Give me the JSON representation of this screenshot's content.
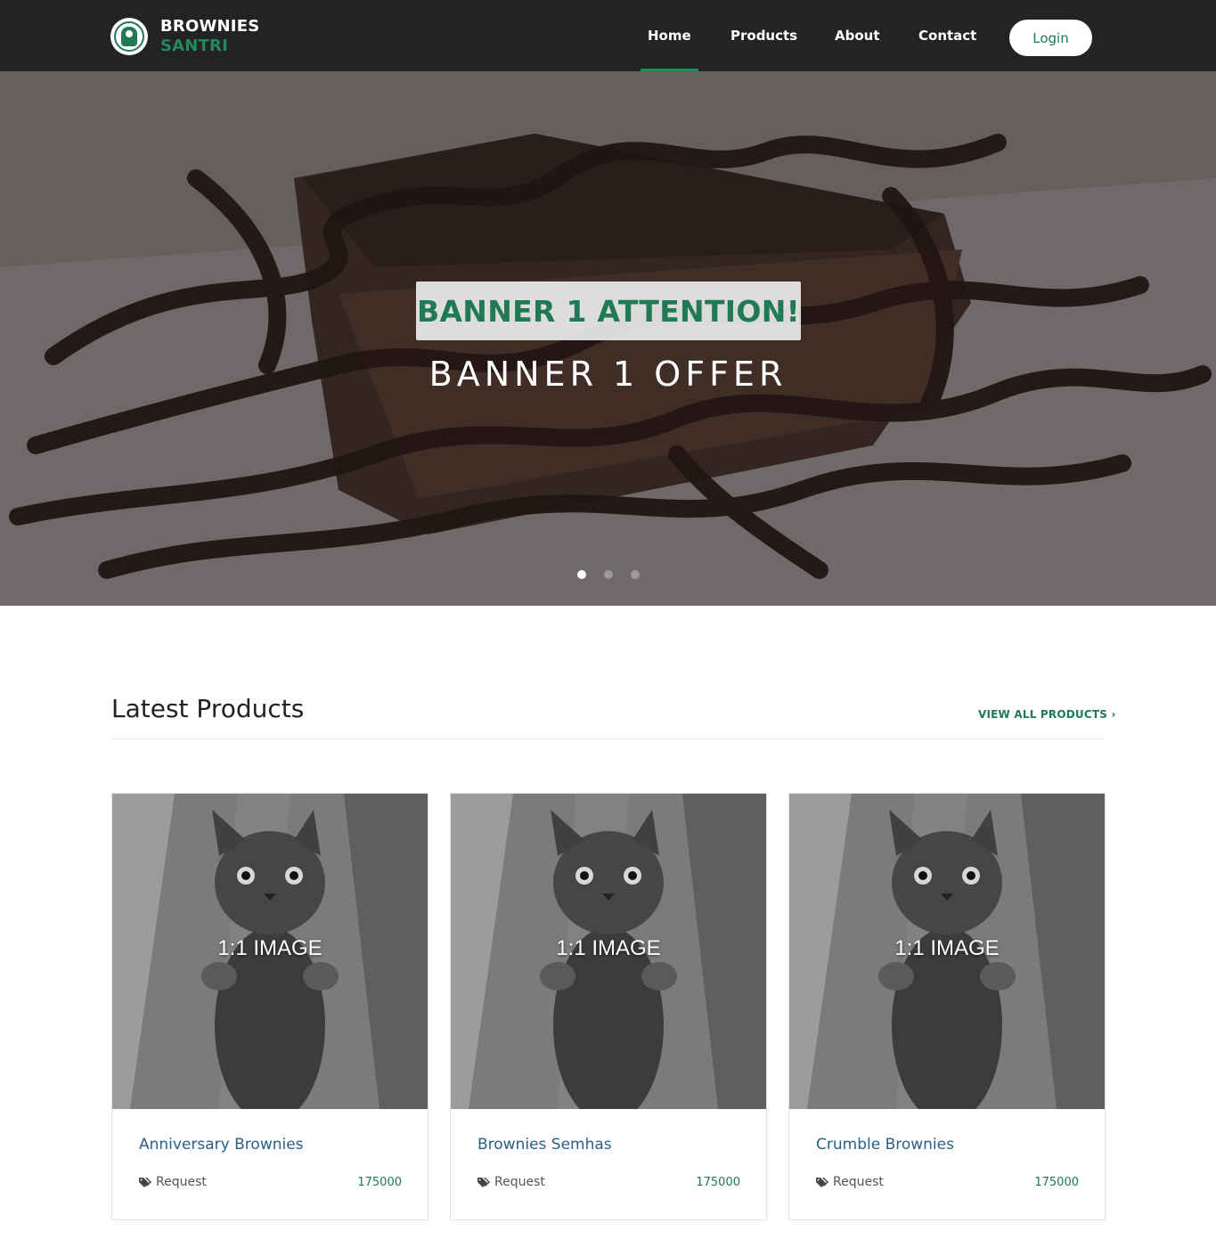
{
  "brand": {
    "line1": "BROWNIES",
    "line2": "SANTRI"
  },
  "nav": {
    "items": [
      {
        "label": "Home",
        "active": true
      },
      {
        "label": "Products",
        "active": false
      },
      {
        "label": "About",
        "active": false
      },
      {
        "label": "Contact",
        "active": false
      }
    ],
    "login_label": "Login"
  },
  "hero": {
    "attention": "BANNER 1 ATTENTION!",
    "offer": "BANNER 1 OFFER",
    "slides_count": 3,
    "active_slide": 1
  },
  "latest": {
    "title": "Latest Products",
    "view_all": "VIEW ALL PRODUCTS",
    "products": [
      {
        "image_label": "1:1 IMAGE",
        "name": "Anniversary Brownies",
        "category": "Request",
        "price": "175000"
      },
      {
        "image_label": "1:1 IMAGE",
        "name": "Brownies Semhas",
        "category": "Request",
        "price": "175000"
      },
      {
        "image_label": "1:1 IMAGE",
        "name": "Crumble Brownies",
        "category": "Request",
        "price": "175000"
      }
    ]
  },
  "colors": {
    "nav_bg": "#232323",
    "accent_green": "#1f7a55",
    "title_blue": "#2b5f86"
  }
}
